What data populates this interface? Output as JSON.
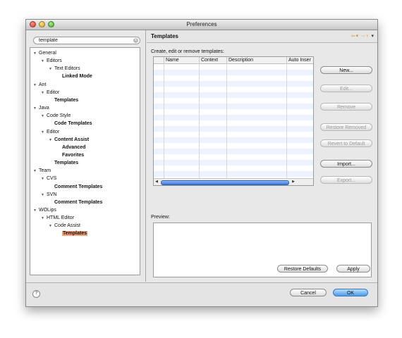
{
  "window": {
    "title": "Preferences"
  },
  "search": {
    "value": "template"
  },
  "tree": [
    {
      "label": "General",
      "level": 0,
      "arrow": true,
      "bold": false
    },
    {
      "label": "Editors",
      "level": 1,
      "arrow": true,
      "bold": false
    },
    {
      "label": "Text Editors",
      "level": 2,
      "arrow": true,
      "bold": false
    },
    {
      "label": "Linked Mode",
      "level": 3,
      "arrow": false,
      "bold": true
    },
    {
      "label": "Ant",
      "level": 0,
      "arrow": true,
      "bold": false
    },
    {
      "label": "Editor",
      "level": 1,
      "arrow": true,
      "bold": false
    },
    {
      "label": "Templates",
      "level": 2,
      "arrow": false,
      "bold": true
    },
    {
      "label": "Java",
      "level": 0,
      "arrow": true,
      "bold": false
    },
    {
      "label": "Code Style",
      "level": 1,
      "arrow": true,
      "bold": false
    },
    {
      "label": "Code Templates",
      "level": 2,
      "arrow": false,
      "bold": true
    },
    {
      "label": "Editor",
      "level": 1,
      "arrow": true,
      "bold": false
    },
    {
      "label": "Content Assist",
      "level": 2,
      "arrow": true,
      "bold": true
    },
    {
      "label": "Advanced",
      "level": 3,
      "arrow": false,
      "bold": true
    },
    {
      "label": "Favorites",
      "level": 3,
      "arrow": false,
      "bold": true
    },
    {
      "label": "Templates",
      "level": 2,
      "arrow": false,
      "bold": true
    },
    {
      "label": "Team",
      "level": 0,
      "arrow": true,
      "bold": false
    },
    {
      "label": "CVS",
      "level": 1,
      "arrow": true,
      "bold": false
    },
    {
      "label": "Comment Templates",
      "level": 2,
      "arrow": false,
      "bold": true
    },
    {
      "label": "SVN",
      "level": 1,
      "arrow": true,
      "bold": false
    },
    {
      "label": "Comment Templates",
      "level": 2,
      "arrow": false,
      "bold": true
    },
    {
      "label": "WOLips",
      "level": 0,
      "arrow": true,
      "bold": false
    },
    {
      "label": "HTML Editor",
      "level": 1,
      "arrow": true,
      "bold": false
    },
    {
      "label": "Code Assist",
      "level": 2,
      "arrow": true,
      "bold": false
    },
    {
      "label": "Templates",
      "level": 3,
      "arrow": false,
      "bold": true,
      "selected": true
    }
  ],
  "page": {
    "title": "Templates",
    "description": "Create, edit or remove templates:",
    "preview_label": "Preview:"
  },
  "table": {
    "columns": [
      "Name",
      "Context",
      "Description",
      "Auto Inser"
    ]
  },
  "buttons": {
    "new": "New...",
    "edit": "Edit...",
    "remove": "Remove",
    "restore_removed": "Restore Removed",
    "revert": "Revert to Default",
    "import": "Import...",
    "export": "Export...",
    "restore_defaults": "Restore Defaults",
    "apply": "Apply",
    "cancel": "Cancel",
    "ok": "OK"
  },
  "icons": {
    "help": "?",
    "clear": "x"
  }
}
